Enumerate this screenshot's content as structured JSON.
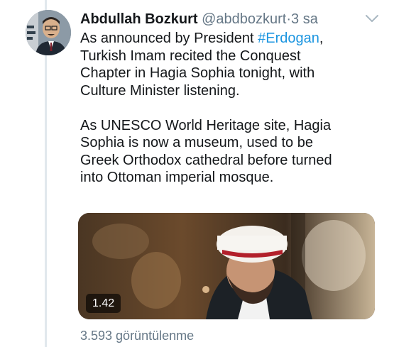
{
  "colors": {
    "text_primary": "#14171a",
    "text_secondary": "#657786",
    "link": "#1b95e0",
    "thread_line": "#e1e8ed"
  },
  "tweet": {
    "author": {
      "display_name": "Abdullah Bozkurt",
      "handle": "@abdbozkurt",
      "avatar_icon": "avatar-photo"
    },
    "separator": "·",
    "time": "3 sa",
    "menu_icon": "chevron-down-icon",
    "text": {
      "p1_before": "As announced by President ",
      "hashtag": "#Erdogan",
      "p1_after": ",\nTurkish Imam recited the Conquest\nChapter in Hagia Sophia tonight, with\nCulture Minister listening.",
      "p2": "As UNESCO World Heritage site, Hagia\nSophia is now a museum, used to be\nGreek Orthodox cathedral before turned\ninto Ottoman imperial mosque."
    },
    "media": {
      "type": "video",
      "duration": "1.42"
    },
    "views": "3.593 görüntülenme"
  }
}
